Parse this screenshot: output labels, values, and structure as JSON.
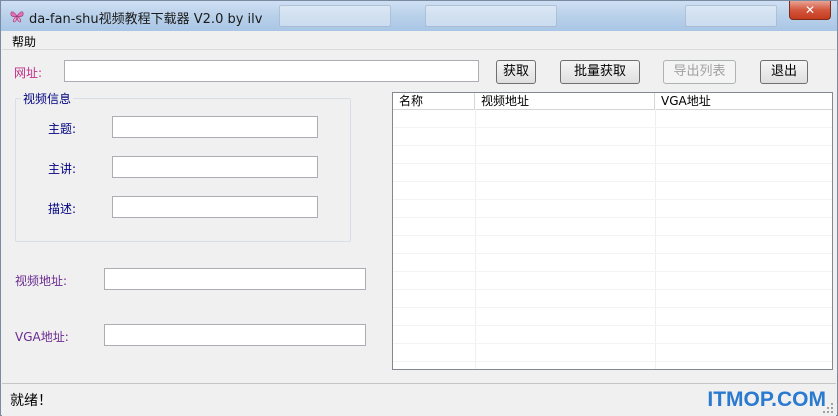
{
  "window": {
    "title": "da-fan-shu视频教程下载器 V2.0 by ilv",
    "close_label": "✕"
  },
  "menu": {
    "items": [
      "帮助"
    ]
  },
  "url_row": {
    "label": "网址:",
    "value": "",
    "buttons": {
      "fetch": "获取",
      "batch_fetch": "批量获取",
      "export_list": "导出列表",
      "exit": "退出"
    }
  },
  "video_info": {
    "group_title": "视频信息",
    "subject_label": "主题:",
    "subject_value": "",
    "speaker_label": "主讲:",
    "speaker_value": "",
    "description_label": "描述:",
    "description_value": ""
  },
  "video_url": {
    "label": "视频地址:",
    "value": ""
  },
  "vga_url": {
    "label": "VGA地址:",
    "value": ""
  },
  "list": {
    "columns": [
      "名称",
      "视频地址",
      "VGA地址"
    ],
    "rows": []
  },
  "status": {
    "text": "就绪！"
  },
  "watermark": "ITMOP.COM",
  "colors": {
    "label_red": "#c0308a",
    "label_navy": "#000080",
    "label_purple": "#6a2a90",
    "watermark_blue": "#2a7ad0"
  }
}
